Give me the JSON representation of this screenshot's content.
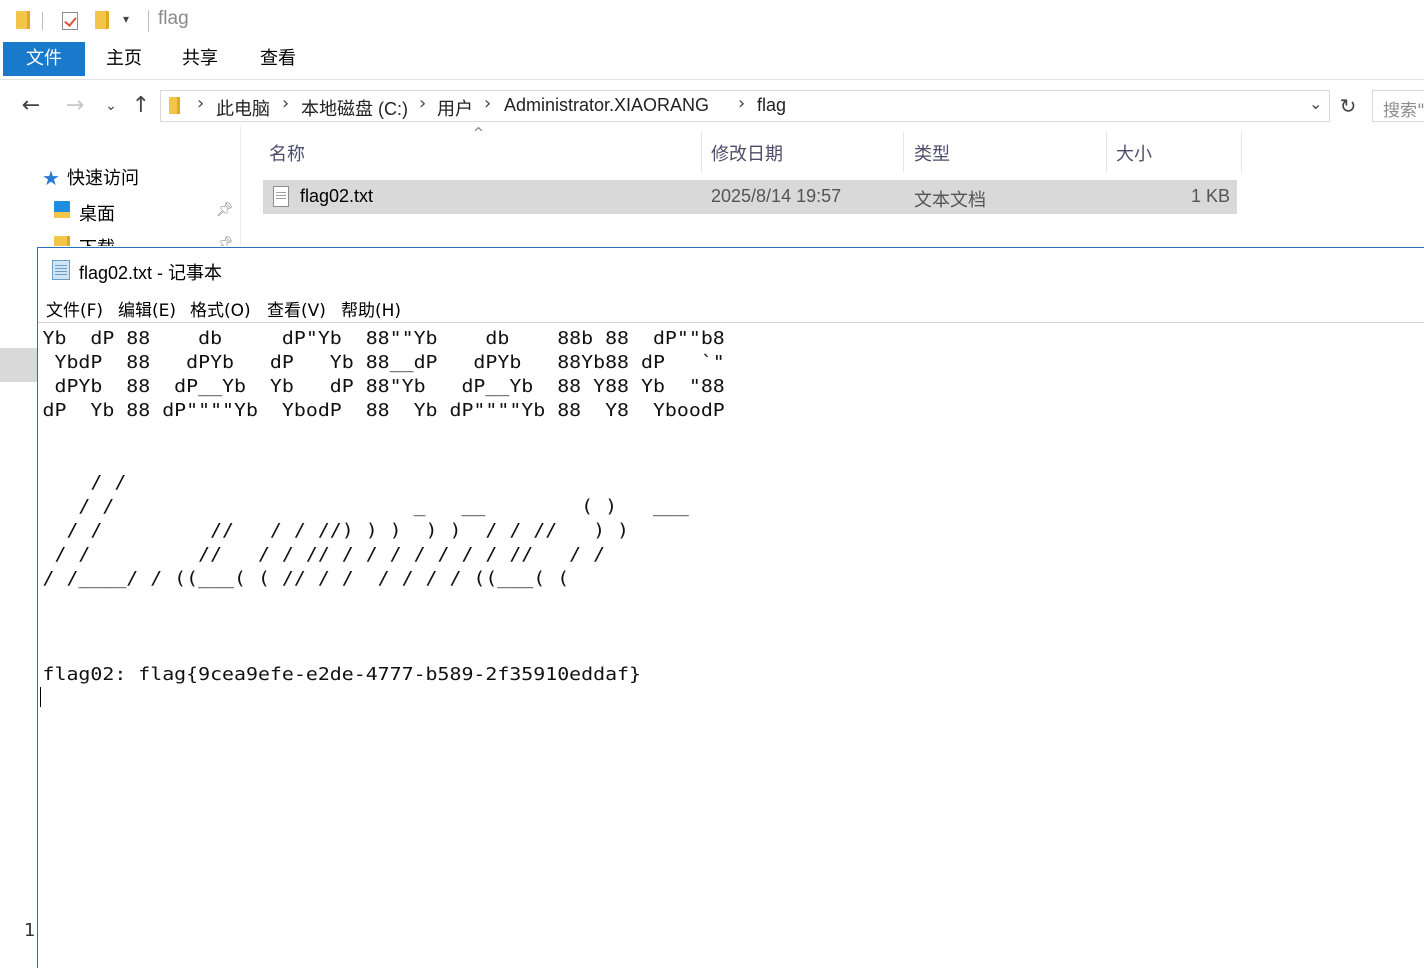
{
  "explorer": {
    "qat_title": "flag",
    "ribbon_tabs": [
      "文件",
      "主页",
      "共享",
      "查看"
    ],
    "breadcrumb": [
      "此电脑",
      "本地磁盘 (C:)",
      "用户",
      "Administrator.XIAORANG",
      "flag"
    ],
    "search_placeholder": "搜索\"",
    "nav": {
      "quick_access": "快速访问",
      "desktop": "桌面",
      "downloads": "下载"
    },
    "columns": [
      "名称",
      "修改日期",
      "类型",
      "大小"
    ],
    "files": [
      {
        "name": "flag02.txt",
        "modified": "2025/8/14 19:57",
        "type": "文本文档",
        "size": "1 KB"
      }
    ],
    "status_count": "1"
  },
  "notepad": {
    "title": "flag02.txt - 记事本",
    "menu": [
      "文件(F)",
      "编辑(E)",
      "格式(O)",
      "查看(V)",
      "帮助(H)"
    ],
    "content": "Yb  dP 88    db     dP\"Yb  88\"\"Yb    db    88b 88  dP\"\"b8\n YbdP  88   dPYb   dP   Yb 88__dP   dPYb   88Yb88 dP   `\"\n dPYb  88  dP__Yb  Yb   dP 88\"Yb   dP__Yb  88 Y88 Yb  \"88\ndP  Yb 88 dP\"\"\"\"Yb  YbodP  88  Yb dP\"\"\"\"Yb 88  Y8  YboodP\n\n\n    / /\n   / /                         _   __        ( )   ___\n  / /         //   / / //) ) )  ) )  / / //   ) )\n / /         //   / / // / / / / / / / //   / /\n/ /____/ / ((___( ( // / /  / / / / ((___( (\n\n\n\nflag02: flag{9cea9efe-e2de-4777-b589-2f35910eddaf}\n"
  }
}
